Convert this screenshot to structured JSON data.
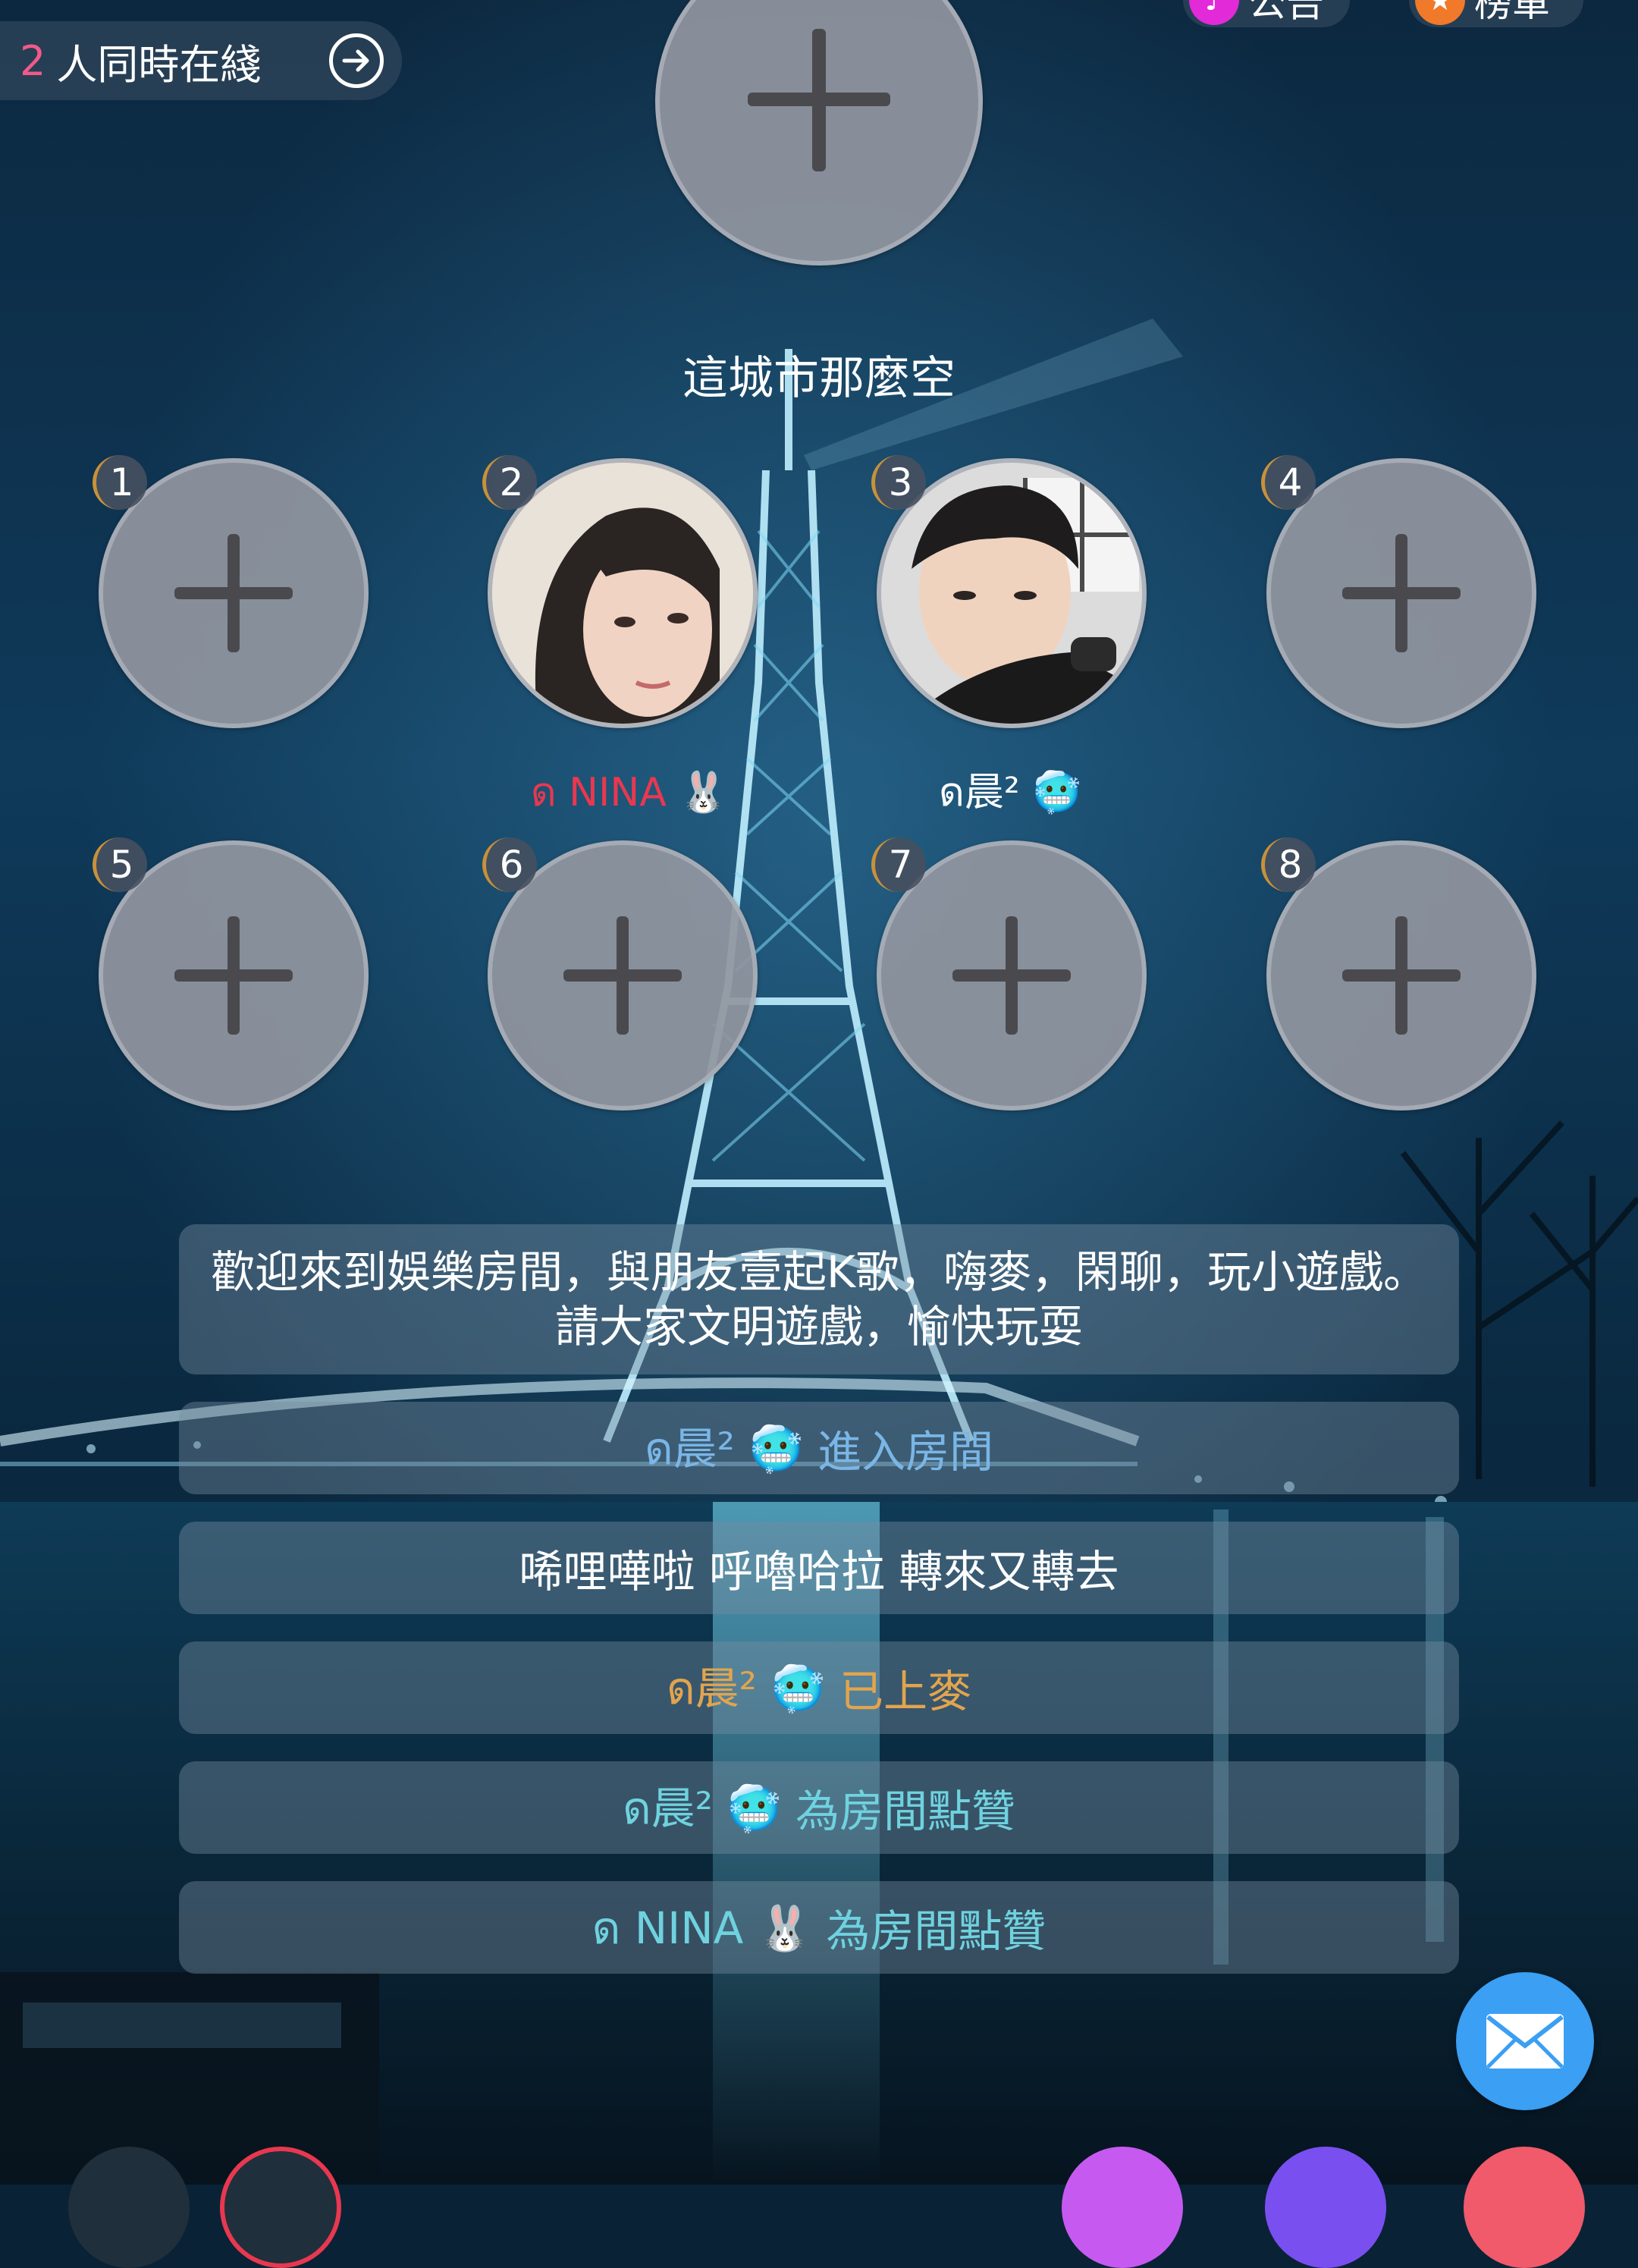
{
  "colors": {
    "online_count": "#f05a8a",
    "nina_name": "#e8384f",
    "enter_message": "#7ab6e6",
    "on_mic_message": "#e2a44e",
    "like_message": "#6fd2df",
    "mail_button": "#3b9ff3"
  },
  "header": {
    "online_count": "2",
    "online_label": "人同時在綫",
    "notice_label": "公告",
    "rank_label": "榜單"
  },
  "room": {
    "title": "這城市那麼空"
  },
  "seats": [
    {
      "number": "1",
      "occupied": false,
      "name": ""
    },
    {
      "number": "2",
      "occupied": true,
      "name": "ด NINA 🐰"
    },
    {
      "number": "3",
      "occupied": true,
      "name": "ด晨² 🥶"
    },
    {
      "number": "4",
      "occupied": false,
      "name": ""
    },
    {
      "number": "5",
      "occupied": false,
      "name": ""
    },
    {
      "number": "6",
      "occupied": false,
      "name": ""
    },
    {
      "number": "7",
      "occupied": false,
      "name": ""
    },
    {
      "number": "8",
      "occupied": false,
      "name": ""
    }
  ],
  "chat": {
    "welcome": "歡迎來到娛樂房間，與朋友壹起K歌，嗨麥，閑聊，玩小遊戲。請大家文明遊戲，愉快玩耍",
    "messages": [
      {
        "user": "ด晨² 🥶",
        "text": "進入房間"
      },
      {
        "user": "",
        "text": "唏哩嘩啦 呼嚕哈拉 轉來又轉去"
      },
      {
        "user": "ด晨² 🥶",
        "text": "已上麥"
      },
      {
        "user": "ด晨² 🥶",
        "text": "為房間點贊"
      },
      {
        "user": "ด NINA 🐰",
        "text": "為房間點贊"
      }
    ]
  },
  "icons": {
    "arrow": "arrow-right-circle-icon",
    "mail": "mail-icon",
    "plus": "plus-icon"
  }
}
